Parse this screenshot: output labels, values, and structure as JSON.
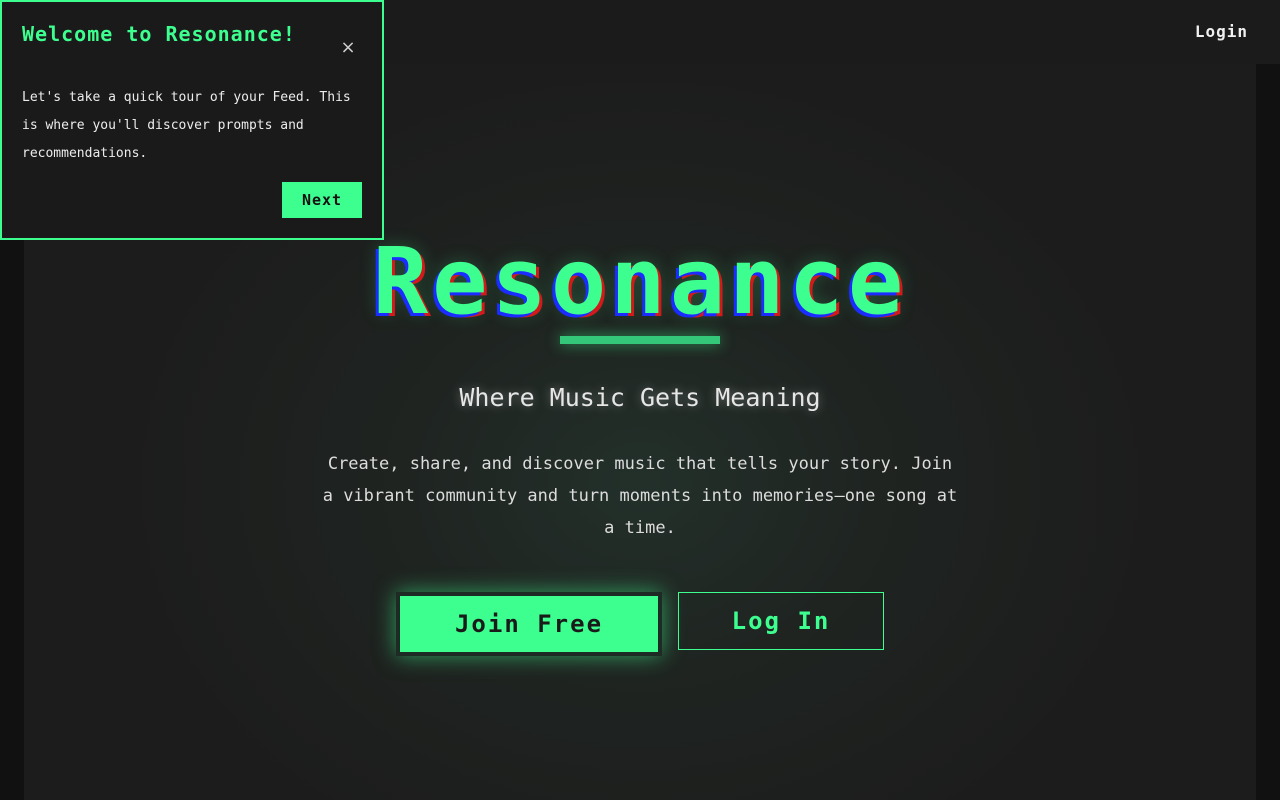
{
  "header": {
    "login_label": "Login"
  },
  "hero": {
    "title": "Resonance",
    "tagline": "Where Music Gets Meaning",
    "description": "Create, share, and discover music that tells your story. Join a vibrant community and turn moments into memories—one song at a time.",
    "join_label": "Join Free",
    "login_label": "Log In"
  },
  "tour": {
    "title": "Welcome to Resonance!",
    "close_icon": "×",
    "body": "Let's take a quick tour of your Feed. This is where you'll discover prompts and recommendations.",
    "next_label": "Next"
  },
  "colors": {
    "accent": "#3dff8f",
    "background": "#1c1c1c",
    "topbar": "#1b1b1b"
  }
}
